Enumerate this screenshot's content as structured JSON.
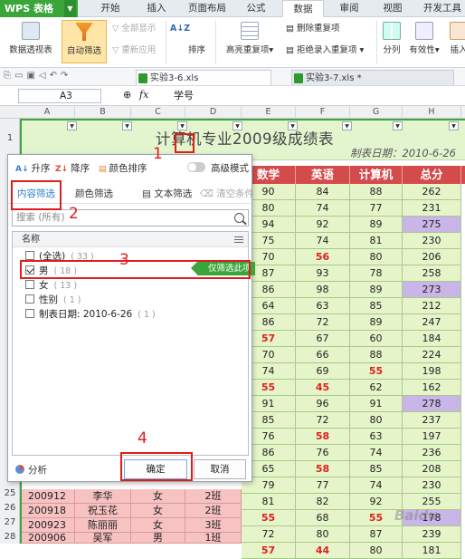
{
  "menubar": {
    "app_name": "WPS 表格",
    "tabs": [
      "开始",
      "插入",
      "页面布局",
      "公式",
      "数据",
      "审阅",
      "视图",
      "开发工具"
    ],
    "active_tab": "数据"
  },
  "ribbon": {
    "pivot": "数据透视表",
    "autofilter": "自动筛选",
    "show_all": "全部显示",
    "reapply": "重新应用",
    "sort_az": "A↓Z",
    "sort": "排序",
    "highlight_dup": "高亮重复项",
    "remove_dup": "删除重复项",
    "reject_dup": "拒绝录入重复项",
    "split": "分列",
    "validity": "有效性",
    "insert": "插入"
  },
  "doc_tabs": [
    "实验3-6.xls",
    "实验3-7.xls *"
  ],
  "formulabar": {
    "cell_ref": "A3",
    "fx": "fx",
    "content": "学号"
  },
  "columns": [
    "A",
    "B",
    "C",
    "D",
    "E",
    "F",
    "G",
    "H"
  ],
  "rows": [
    "1",
    "",
    "",
    "",
    "",
    "",
    "",
    "",
    "",
    "",
    "",
    "",
    "",
    "",
    "",
    "",
    "",
    "",
    "",
    "",
    "",
    "",
    "",
    "",
    "25",
    "26",
    "27",
    "28"
  ],
  "sheet": {
    "title": "计算机专业2009级成绩表",
    "date_label": "制表日期：2010-6-26",
    "headers": [
      "数学",
      "英语",
      "计算机",
      "总分"
    ]
  },
  "grid": [
    [
      "90",
      "84",
      "88",
      "262"
    ],
    [
      "80",
      "74",
      "77",
      "231"
    ],
    [
      "94",
      "92",
      "89",
      "275"
    ],
    [
      "75",
      "74",
      "81",
      "230"
    ],
    [
      "70",
      "56",
      "80",
      "206"
    ],
    [
      "87",
      "93",
      "78",
      "258"
    ],
    [
      "86",
      "98",
      "89",
      "273"
    ],
    [
      "64",
      "63",
      "85",
      "212"
    ],
    [
      "86",
      "72",
      "89",
      "247"
    ],
    [
      "57",
      "67",
      "60",
      "184"
    ],
    [
      "70",
      "66",
      "88",
      "224"
    ],
    [
      "74",
      "69",
      "55",
      "198"
    ],
    [
      "55",
      "45",
      "62",
      "162"
    ],
    [
      "91",
      "96",
      "91",
      "278"
    ],
    [
      "85",
      "72",
      "80",
      "237"
    ],
    [
      "76",
      "58",
      "63",
      "197"
    ],
    [
      "86",
      "76",
      "74",
      "236"
    ],
    [
      "65",
      "58",
      "85",
      "208"
    ],
    [
      "79",
      "77",
      "74",
      "230"
    ],
    [
      "81",
      "82",
      "92",
      "255"
    ],
    [
      "55",
      "68",
      "55",
      "178"
    ],
    [
      "72",
      "80",
      "87",
      "239"
    ],
    [
      "57",
      "44",
      "80",
      "181"
    ]
  ],
  "bottom_rows": [
    [
      "200912",
      "李华",
      "女",
      "2班"
    ],
    [
      "200918",
      "祝玉花",
      "女",
      "2班"
    ],
    [
      "200923",
      "陈丽丽",
      "女",
      "3班"
    ],
    [
      "200906",
      "吴军",
      "男",
      "1班"
    ]
  ],
  "filter_panel": {
    "sort_asc": "升序",
    "sort_desc": "降序",
    "sort_color": "颜色排序",
    "advanced": "高级模式",
    "tab_content": "内容筛选",
    "tab_color": "颜色筛选",
    "tab_text": "文本筛选",
    "clear": "清空条件",
    "search_placeholder": "搜索 (所有)",
    "list_header": "名称",
    "items": [
      {
        "label": "(全选)",
        "count": "( 33 )",
        "checked": false
      },
      {
        "label": "男",
        "count": "( 18 )",
        "checked": true
      },
      {
        "label": "女",
        "count": "( 13 )",
        "checked": false
      },
      {
        "label": "性别",
        "count": "( 1 )",
        "checked": false
      },
      {
        "label": "制表日期: 2010-6-26",
        "count": "( 1 )",
        "checked": false
      }
    ],
    "only_this": "仅筛选此项",
    "analyze": "分析",
    "ok": "确定",
    "cancel": "取消"
  },
  "annotations": [
    "1",
    "2",
    "3",
    "4"
  ],
  "watermark": "Baidu"
}
